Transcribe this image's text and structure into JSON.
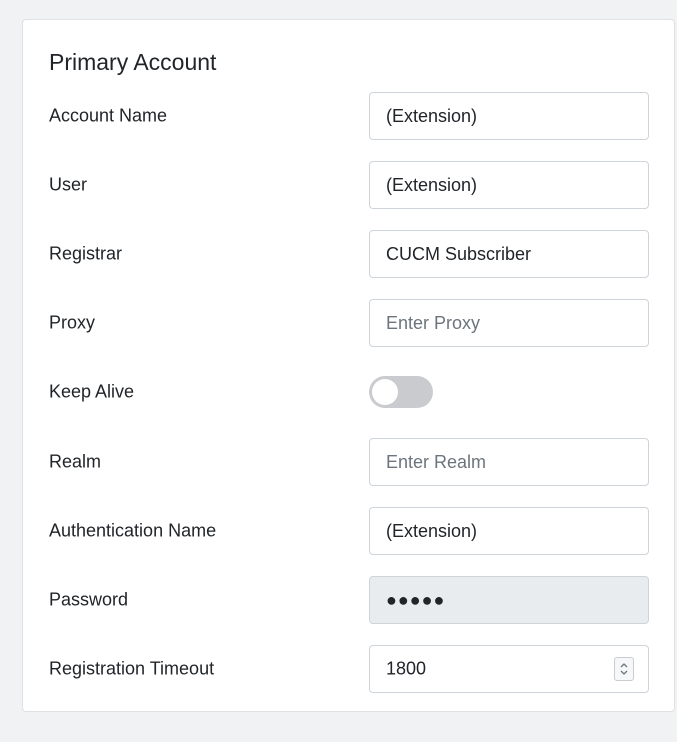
{
  "card": {
    "title": "Primary Account"
  },
  "fields": {
    "account_name": {
      "label": "Account Name",
      "value": "(Extension)"
    },
    "user": {
      "label": "User",
      "value": "(Extension)"
    },
    "registrar": {
      "label": "Registrar",
      "value": "CUCM Subscriber"
    },
    "proxy": {
      "label": "Proxy",
      "value": "",
      "placeholder": "Enter Proxy"
    },
    "keep_alive": {
      "label": "Keep Alive",
      "enabled": false
    },
    "realm": {
      "label": "Realm",
      "value": "",
      "placeholder": "Enter Realm"
    },
    "auth_name": {
      "label": "Authentication Name",
      "value": "(Extension)"
    },
    "password": {
      "label": "Password",
      "masked_value": "●●●●●"
    },
    "registration_timeout": {
      "label": "Registration Timeout",
      "value": "1800"
    }
  },
  "icons": {
    "spinner": "up-down-chevron-icon"
  },
  "colors": {
    "toggle_off": "#c9cbcf",
    "disabled_field": "#e9ecef",
    "border": "#ced4da"
  }
}
